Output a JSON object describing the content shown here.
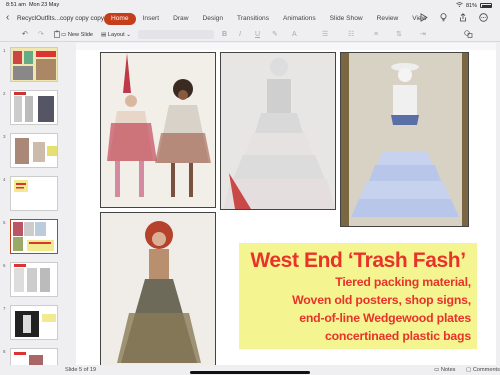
{
  "status": {
    "time": "8:51 am",
    "date": "Mon 23 May",
    "battery": "81%"
  },
  "app": {
    "filename": "RecyclOutfits...copy copy copy"
  },
  "tabs": [
    {
      "label": "Home",
      "active": true
    },
    {
      "label": "Insert"
    },
    {
      "label": "Draw"
    },
    {
      "label": "Design"
    },
    {
      "label": "Transitions"
    },
    {
      "label": "Animations"
    },
    {
      "label": "Slide Show"
    },
    {
      "label": "Review"
    },
    {
      "label": "View"
    }
  ],
  "toolbar": {
    "new_slide": "New Slide",
    "layout": "Layout"
  },
  "thumbnails": [
    {
      "num": "1"
    },
    {
      "num": "2"
    },
    {
      "num": "3"
    },
    {
      "num": "4"
    },
    {
      "num": "5",
      "selected": true
    },
    {
      "num": "6"
    },
    {
      "num": "7"
    },
    {
      "num": "8"
    }
  ],
  "slide": {
    "title": "West End ‘Trash Fash’",
    "lines": [
      "Tiered packing material,",
      "Woven old posters, shop signs,",
      "end-of-line Wedgewood plates",
      "concertinaed plastic bags"
    ]
  },
  "footer": {
    "slide_info": "Slide 5 of 19",
    "notes": "Notes",
    "comments": "Comments"
  },
  "colors": {
    "accent": "#c43e1c",
    "caption_bg": "#f4f590",
    "caption_text": "#e8322a"
  }
}
